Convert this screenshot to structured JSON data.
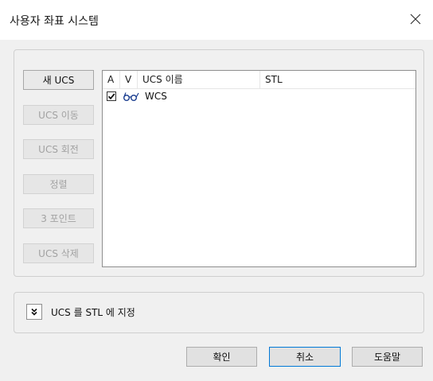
{
  "window": {
    "title": "사용자 좌표 시스템",
    "close_glyph": "✕"
  },
  "sidebar": {
    "buttons": [
      {
        "label": "새 UCS",
        "enabled": true
      },
      {
        "label": "UCS 이동",
        "enabled": false
      },
      {
        "label": "UCS 회전",
        "enabled": false
      },
      {
        "label": "정렬",
        "enabled": false
      },
      {
        "label": "3 포인트",
        "enabled": false
      },
      {
        "label": "UCS 삭제",
        "enabled": false
      }
    ]
  },
  "ucs_list": {
    "columns": [
      "A",
      "V",
      "UCS 이름",
      "STL"
    ],
    "rows": [
      {
        "active": true,
        "visible_icon": "glasses-icon",
        "name": "WCS",
        "stl": ""
      }
    ]
  },
  "assign": {
    "toggle_icon": "chevrons-down-icon",
    "label": "UCS 를 STL 에 지정"
  },
  "footer": {
    "ok_label": "확인",
    "cancel_label": "취소",
    "help_label": "도움말"
  },
  "colors": {
    "dialog_bg": "#f0f0f0",
    "default_button_border": "#0078d7",
    "disabled_text": "#a2a2a2"
  }
}
